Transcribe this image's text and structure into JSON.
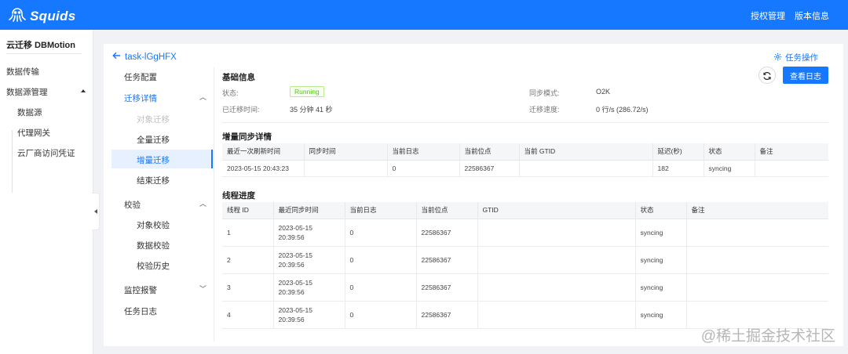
{
  "brand": {
    "name": "Squids",
    "icon": "octopus-logo-icon"
  },
  "topnav": {
    "license": "授权管理",
    "version": "版本信息"
  },
  "sidebar": {
    "title": "云迁移 DBMotion",
    "data_transfer": "数据传输",
    "datasource_mgmt": "数据源管理",
    "datasource": "数据源",
    "proxy_gateway": "代理网关",
    "vendor_credentials": "云厂商访问凭证"
  },
  "task": {
    "back_label": "task-lGgHFX",
    "ops_label": "任务操作"
  },
  "nav": {
    "task_config": "任务配置",
    "migration_detail": "迁移详情",
    "object_migration": "对象迁移",
    "full_migration": "全量迁移",
    "incremental_migration": "增量迁移",
    "end_migration": "结束迁移",
    "verify": "校验",
    "object_verify": "对象校验",
    "data_verify": "数据校验",
    "verify_history": "校验历史",
    "monitor_alert": "监控报警",
    "task_log": "任务日志"
  },
  "basic": {
    "title": "基础信息",
    "status_label": "状态:",
    "status_value": "Running",
    "sync_mode_label": "同步模式:",
    "sync_mode_value": "O2K",
    "elapsed_label": "已迁移时间:",
    "elapsed_value": "35 分钟 41 秒",
    "speed_label": "迁移速度:",
    "speed_value": "0 行/s (286.72/s)",
    "view_log": "查看日志",
    "status_color": "#52c41a"
  },
  "incremental": {
    "title": "增量同步详情",
    "columns": [
      "最近一次刷新时间",
      "同步时间",
      "当前日志",
      "当前位点",
      "当前 GTID",
      "延迟(秒)",
      "状态",
      "备注"
    ],
    "row": [
      "2023-05-15 20:43:23",
      "",
      "0",
      "22586367",
      "",
      "182",
      "syncing",
      ""
    ]
  },
  "threads": {
    "title": "线程进度",
    "columns": [
      "线程 ID",
      "最近同步时间",
      "当前日志",
      "当前位点",
      "GTID",
      "状态",
      "备注"
    ],
    "rows": [
      {
        "id": "1",
        "date": "2023-05-15",
        "time": "20:39:56",
        "log": "0",
        "pos": "22586367",
        "gtid": "",
        "status": "syncing",
        "note": ""
      },
      {
        "id": "2",
        "date": "2023-05-15",
        "time": "20:39:56",
        "log": "0",
        "pos": "22586367",
        "gtid": "",
        "status": "syncing",
        "note": ""
      },
      {
        "id": "3",
        "date": "2023-05-15",
        "time": "20:39:56",
        "log": "0",
        "pos": "22586367",
        "gtid": "",
        "status": "syncing",
        "note": ""
      },
      {
        "id": "4",
        "date": "2023-05-15",
        "time": "20:39:56",
        "log": "0",
        "pos": "22586367",
        "gtid": "",
        "status": "syncing",
        "note": ""
      }
    ]
  },
  "watermark": "@稀土掘金技术社区",
  "accent_color": "#1677ff"
}
